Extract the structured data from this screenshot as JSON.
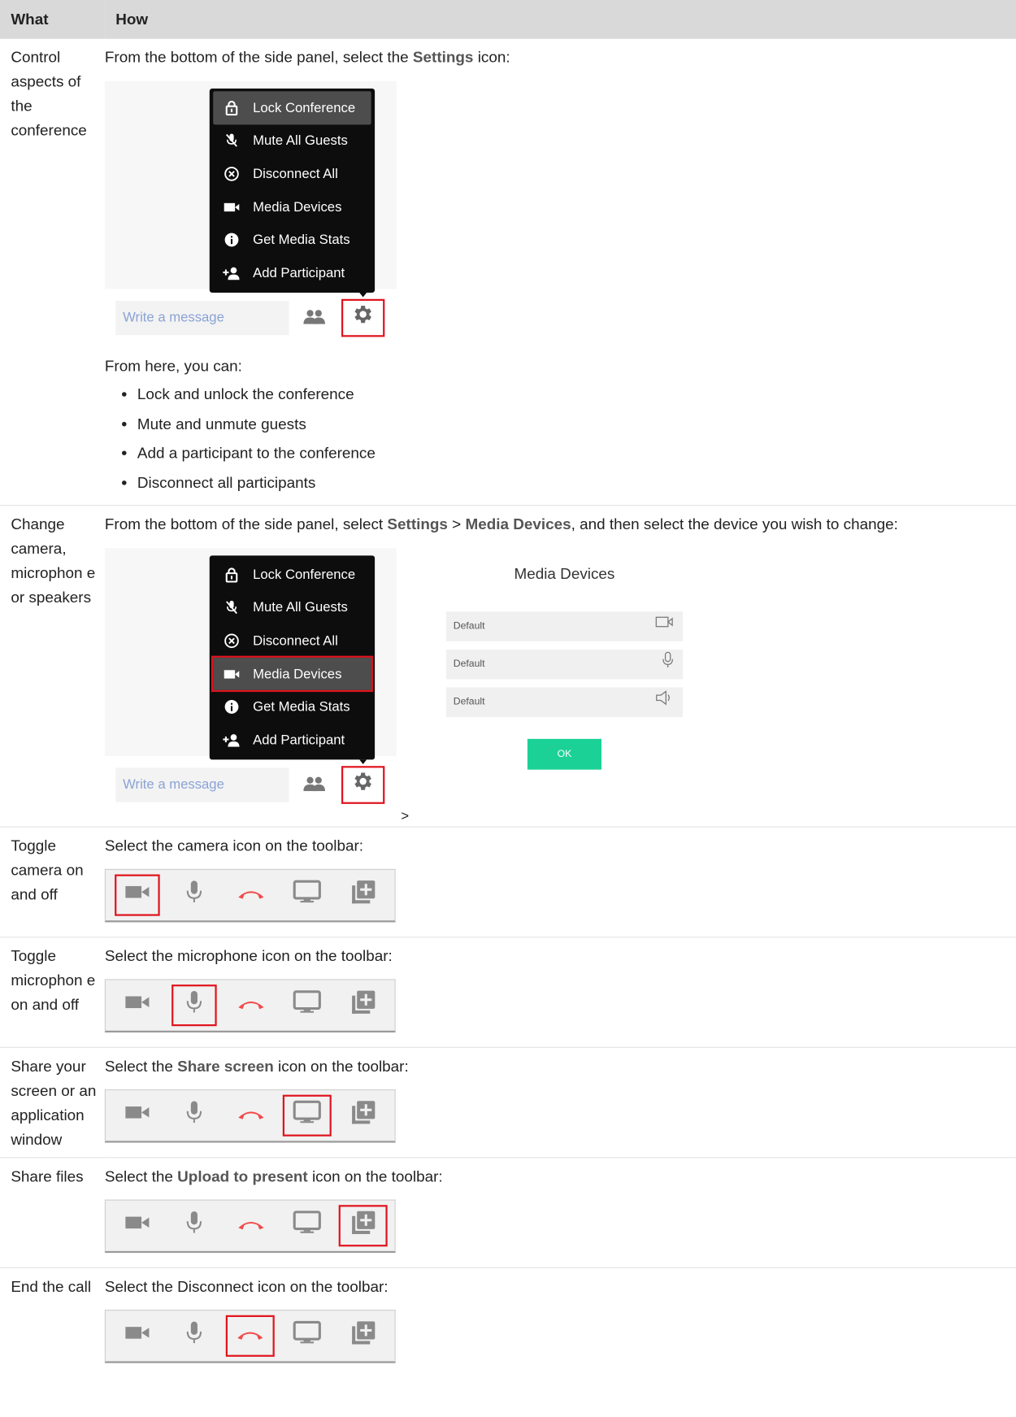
{
  "table": {
    "headers": [
      "What",
      "How"
    ],
    "rows": [
      {
        "what": "Control aspects of the conference",
        "how_pre": "From the bottom of the side panel, select the ",
        "how_bold1": "Settings",
        "how_post": " icon:",
        "from_here": "From here, you can:",
        "bullets": [
          "Lock and unlock the conference",
          "Mute and unmute guests",
          "Add a participant to the conference",
          "Disconnect all participants"
        ]
      },
      {
        "what": "Change camera, microphon e or speakers",
        "how_pre": "From the bottom of the side panel, select ",
        "how_bold1": "Settings",
        "how_mid": " > ",
        "how_bold2": "Media Devices",
        "how_post": ", and then select the device you wish to change:",
        "arrow": ">"
      },
      {
        "what": "Toggle camera on and off",
        "how": "Select the camera icon on the toolbar:"
      },
      {
        "what": "Toggle microphon e on and off",
        "how": "Select the microphone icon on the toolbar:"
      },
      {
        "what": "Share your screen or an application window",
        "how_pre": "Select the ",
        "how_bold1": "Share screen",
        "how_post": " icon on the toolbar:"
      },
      {
        "what": "Share files",
        "how_pre": "Select the ",
        "how_bold1": "Upload to present",
        "how_post": " icon on the toolbar:"
      },
      {
        "what": "End the call",
        "how": "Select the Disconnect icon on the toolbar:"
      }
    ]
  },
  "settings_menu": {
    "items": [
      {
        "label": "Lock Conference",
        "icon": "lock-icon"
      },
      {
        "label": "Mute All Guests",
        "icon": "mic-off-icon"
      },
      {
        "label": "Disconnect All",
        "icon": "circle-x-icon"
      },
      {
        "label": "Media Devices",
        "icon": "video-camera-icon"
      },
      {
        "label": "Get Media Stats",
        "icon": "info-icon"
      },
      {
        "label": "Add Participant",
        "icon": "person-add-icon"
      }
    ],
    "message_placeholder": "Write a message"
  },
  "media_devices": {
    "title": "Media Devices",
    "devices": [
      {
        "value": "Default",
        "icon": "video-camera-icon"
      },
      {
        "value": "Default",
        "icon": "microphone-icon"
      },
      {
        "value": "Default",
        "icon": "speaker-icon"
      }
    ],
    "ok_label": "OK"
  },
  "toolbar": {
    "icons": [
      "camera-icon",
      "microphone-icon",
      "hang-up-icon",
      "share-screen-icon",
      "upload-icon"
    ]
  },
  "colors": {
    "highlight_red": "#e0141e",
    "ok_green": "#1bd196",
    "hangup_red": "#f24a4a",
    "header_gray": "#d9d9d9"
  }
}
